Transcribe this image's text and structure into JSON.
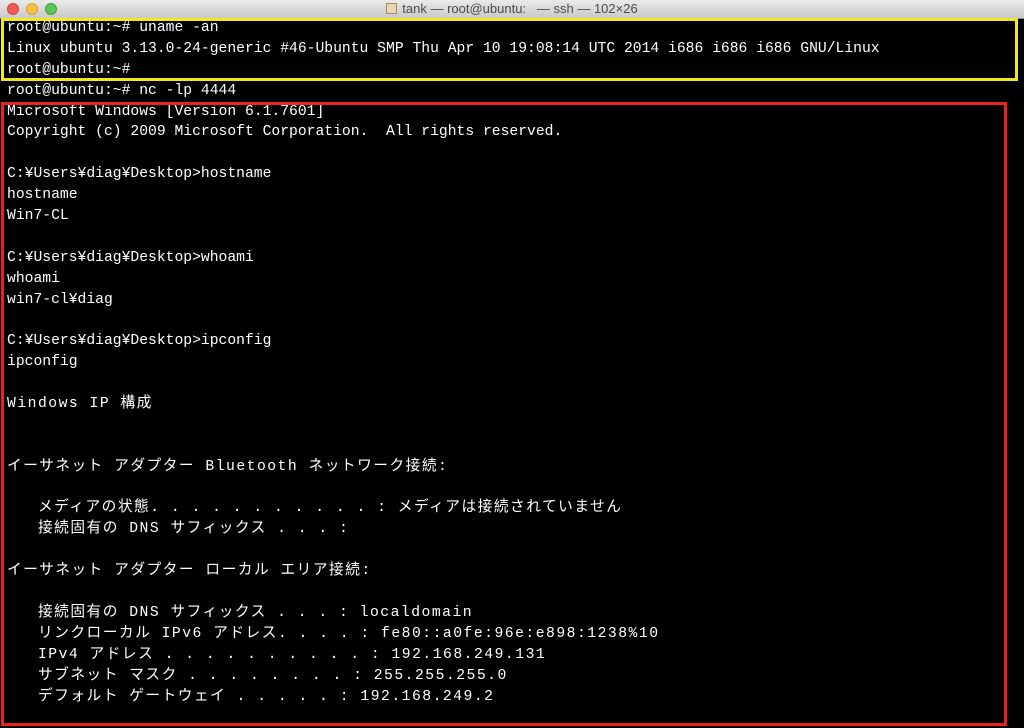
{
  "window": {
    "title": "tank — root@ubuntu:   — ssh — 102×26"
  },
  "colors": {
    "background": "#000000",
    "text": "#ffffff",
    "highlight_upper": "#f2e81a",
    "highlight_lower": "#e8231f"
  },
  "icons": [
    "close-button",
    "minimize-button",
    "zoom-button",
    "home-folder-icon"
  ],
  "terminal": {
    "lines": [
      "root@ubuntu:~# uname -an",
      "Linux ubuntu 3.13.0-24-generic #46-Ubuntu SMP Thu Apr 10 19:08:14 UTC 2014 i686 i686 i686 GNU/Linux",
      "root@ubuntu:~#",
      "root@ubuntu:~# nc -lp 4444",
      "Microsoft Windows [Version 6.1.7601]",
      "Copyright (c) 2009 Microsoft Corporation.  All rights reserved.",
      "",
      "C:¥Users¥diag¥Desktop>hostname",
      "hostname",
      "Win7-CL",
      "",
      "C:¥Users¥diag¥Desktop>whoami",
      "whoami",
      "win7-cl¥diag",
      "",
      "C:¥Users¥diag¥Desktop>ipconfig",
      "ipconfig",
      "",
      "Windows IP 構成",
      "",
      "",
      "イーサネット アダプター Bluetooth ネットワーク接続:",
      "",
      "   メディアの状態. . . . . . . . . . . : メディアは接続されていません",
      "   接続固有の DNS サフィックス . . . :",
      "",
      "イーサネット アダプター ローカル エリア接続:",
      "",
      "   接続固有の DNS サフィックス . . . : localdomain",
      "   リンクローカル IPv6 アドレス. . . . : fe80::a0fe:96e:e898:1238%10",
      "   IPv4 アドレス . . . . . . . . . . : 192.168.249.131",
      "   サブネット マスク . . . . . . . . : 255.255.255.0",
      "   デフォルト ゲートウェイ . . . . . : 192.168.249.2"
    ]
  }
}
